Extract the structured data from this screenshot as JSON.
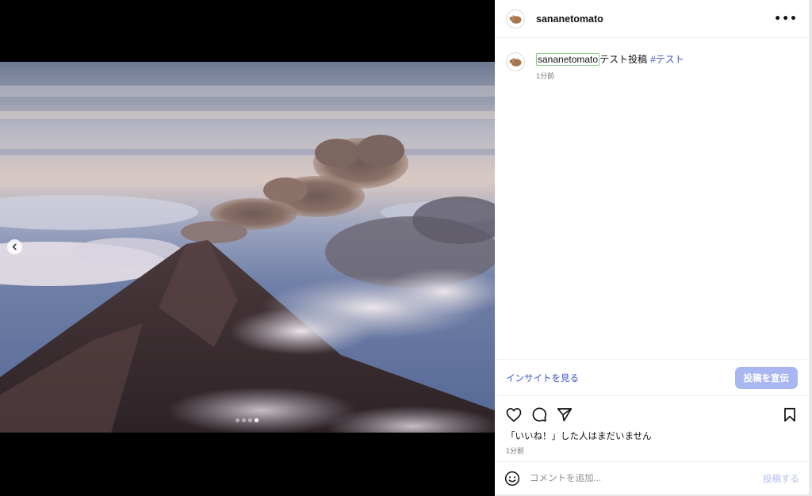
{
  "post": {
    "username": "sananetomato",
    "more_icon": "more-horizontal-icon",
    "caption_user": "sananetomato",
    "caption_text": "テスト投稿",
    "hashtag": "#テスト",
    "caption_time": "1分前",
    "insights_link": "インサイトを見る",
    "promote_button": "投稿を宣伝",
    "likes_text": "「いいね！」した人はまだいません",
    "post_time": "1分前",
    "comment_placeholder": "コメントを追加...",
    "post_button": "投稿する"
  },
  "carousel": {
    "total": 4,
    "active_index": 3
  },
  "colors": {
    "link": "#3b55c9",
    "promote_bg": "#a8b6f2",
    "post_button_disabled": "#b2bdf0"
  },
  "icons": {
    "prev": "chevron-left-icon",
    "like": "heart-icon",
    "comment": "comment-bubble-icon",
    "share": "paper-plane-icon",
    "save": "bookmark-icon",
    "emoji": "emoji-smile-icon",
    "avatar": "capybara-avatar-icon"
  }
}
